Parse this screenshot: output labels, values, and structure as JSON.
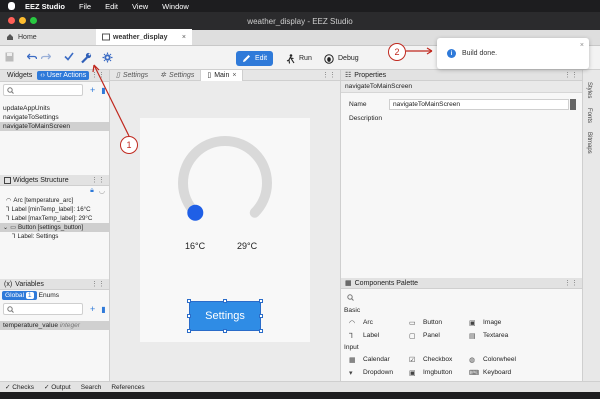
{
  "menubar": {
    "app_name": "EEZ Studio",
    "items": [
      "File",
      "Edit",
      "View",
      "Window"
    ]
  },
  "window": {
    "title": "weather_display - EEZ Studio"
  },
  "tabs": {
    "home_label": "Home",
    "project_label": "weather_display",
    "close_glyph": "×"
  },
  "toolbar": {
    "edit_label": "Edit",
    "run_label": "Run",
    "debug_label": "Debug",
    "icons": [
      "save-icon",
      "undo-icon",
      "redo-icon",
      "check-icon",
      "build-wrench-icon",
      "settings-gear-icon"
    ]
  },
  "left": {
    "widgets_tab": "Widgets",
    "user_actions_tab": "User Actions",
    "actions": [
      "updateAppUnits",
      "navigateToSettings",
      "navigateToMainScreen"
    ],
    "selected_action_index": 2,
    "widgets_structure_title": "Widgets Structure",
    "structure_items": [
      {
        "icon": "arc-icon",
        "label": "Arc [temperature_arc]"
      },
      {
        "icon": "label-icon",
        "label": "Label [minTemp_label]: 16°C"
      },
      {
        "icon": "label-icon",
        "label": "Label [maxTemp_label]: 29°C"
      },
      {
        "icon": "button-icon",
        "label": "Button [settings_button]"
      },
      {
        "icon": "label-icon",
        "label": "Label: Settings"
      }
    ],
    "variables_title": "Variables",
    "global_tab": "Global",
    "global_count": "1",
    "enums_tab": "Enums",
    "variable_name": "temperature_value",
    "variable_type": "integer"
  },
  "canvas": {
    "tabs": [
      "Settings",
      "Settings",
      "Main"
    ],
    "min_temp": "16°C",
    "max_temp": "29°C",
    "button_label": "Settings",
    "arc_value_fraction": 0.0
  },
  "properties": {
    "title": "Properties",
    "subtitle": "navigateToMainScreen",
    "name_label": "Name",
    "name_value": "navigateToMainScreen",
    "description_label": "Description",
    "description_value": ""
  },
  "palette": {
    "title": "Components Palette",
    "basic_label": "Basic",
    "basic_items": [
      "Arc",
      "Button",
      "Image",
      "Label",
      "Panel",
      "Textarea"
    ],
    "input_label": "Input",
    "input_items": [
      "Calendar",
      "Checkbox",
      "Colorwheel",
      "Dropdown",
      "Imgbutton",
      "Keyboard"
    ]
  },
  "right_vertical_tabs": [
    "Styles",
    "Fonts",
    "Bitmaps"
  ],
  "status": {
    "items": [
      "Checks",
      "Output",
      "Search",
      "References"
    ]
  },
  "toast": {
    "message": "Build done."
  },
  "annotations": [
    "1",
    "2"
  ],
  "colors": {
    "accent": "#2f7ad9",
    "button": "#2f8ce5",
    "arc_track": "#d8d8d8",
    "knob": "#1f5fe6",
    "annotation": "#c0281e"
  }
}
